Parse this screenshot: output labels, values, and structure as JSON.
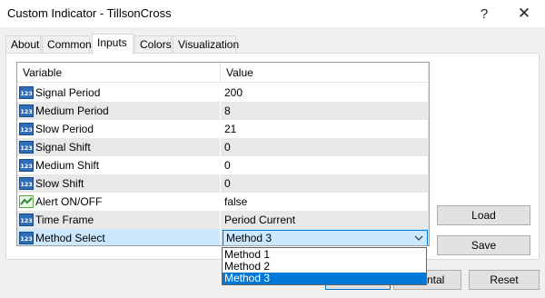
{
  "window": {
    "title": "Custom Indicator - TillsonCross",
    "help_glyph": "?",
    "close_glyph": "✕"
  },
  "tabs": [
    {
      "label": "About"
    },
    {
      "label": "Common"
    },
    {
      "label": "Inputs"
    },
    {
      "label": "Colors"
    },
    {
      "label": "Visualization"
    }
  ],
  "active_tab": "Inputs",
  "grid": {
    "headers": {
      "variable": "Variable",
      "value": "Value"
    },
    "rows": [
      {
        "variable": "Signal Period",
        "value": "200",
        "icon": "int-icon"
      },
      {
        "variable": "Medium Period",
        "value": "8",
        "icon": "int-icon"
      },
      {
        "variable": "Slow Period",
        "value": "21",
        "icon": "int-icon"
      },
      {
        "variable": "Signal Shift",
        "value": "0",
        "icon": "int-icon"
      },
      {
        "variable": "Medium Shift",
        "value": "0",
        "icon": "int-icon"
      },
      {
        "variable": "Slow Shift",
        "value": "0",
        "icon": "int-icon"
      },
      {
        "variable": "Alert ON/OFF",
        "value": "false",
        "icon": "bool-icon"
      },
      {
        "variable": "Time Frame",
        "value": "Period Current",
        "icon": "int-icon"
      },
      {
        "variable": "Method Select",
        "value": "Method 3",
        "icon": "int-icon"
      }
    ],
    "int_icon_text": "123"
  },
  "dropdown": {
    "options": [
      "Method 1",
      "Method 2",
      "Method 3"
    ],
    "selected": "Method 3"
  },
  "buttons": {
    "load": "Load",
    "save": "Save",
    "ok": "",
    "cancel_visible": "ntal",
    "reset": "Reset"
  },
  "colors": {
    "accent": "#0078d7",
    "selected_row": "#cce8ff",
    "odd_row": "#e8e8e8",
    "icon_blue": "#2f6db5"
  }
}
